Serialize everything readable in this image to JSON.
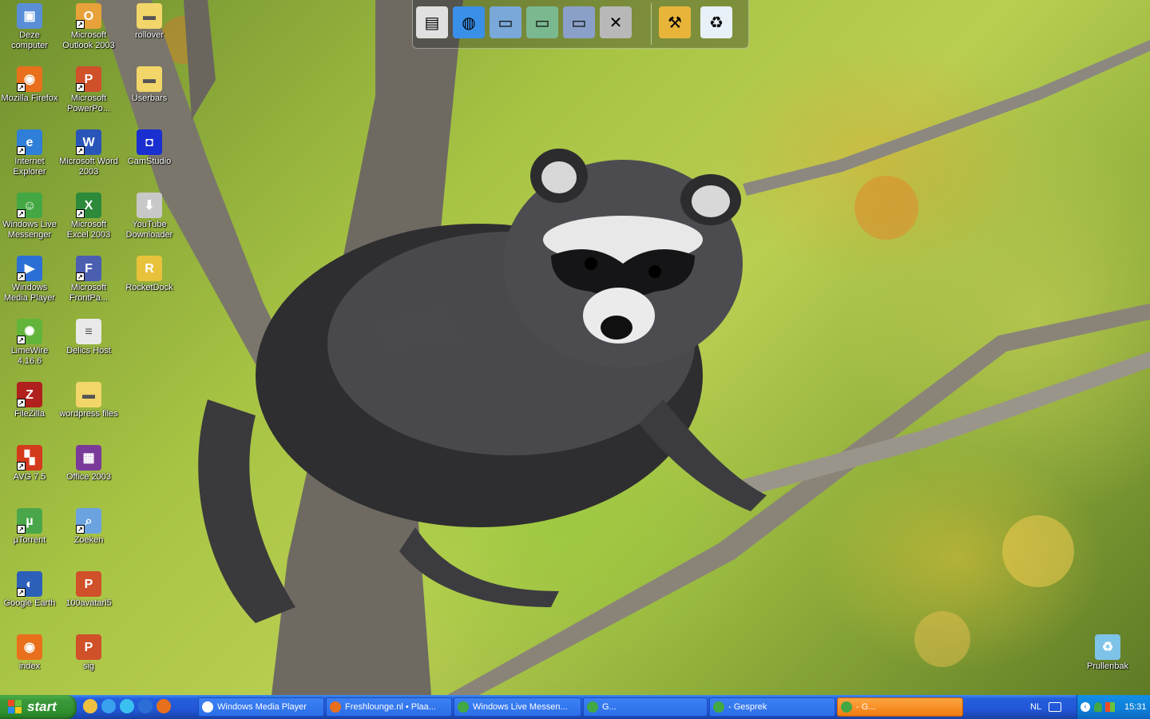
{
  "desktop": {
    "icons": [
      {
        "label": "Deze computer",
        "icon": "computer-icon",
        "color": "#5a8fd8",
        "shortcut": false
      },
      {
        "label": "Mozilla Firefox",
        "icon": "firefox-icon",
        "color": "#e8701c",
        "shortcut": true
      },
      {
        "label": "Internet Explorer",
        "icon": "internet-explorer-icon",
        "color": "#2f7fd8",
        "shortcut": true
      },
      {
        "label": "Windows Live Messenger",
        "icon": "messenger-icon",
        "color": "#43a844",
        "shortcut": true
      },
      {
        "label": "Windows Media Player",
        "icon": "media-player-icon",
        "color": "#2b6fd6",
        "shortcut": true
      },
      {
        "label": "LimeWire 4.16.6",
        "icon": "limewire-icon",
        "color": "#63b43a",
        "shortcut": true
      },
      {
        "label": "FileZilla",
        "icon": "filezilla-icon",
        "color": "#b0201c",
        "shortcut": true
      },
      {
        "label": "AVG 7.5",
        "icon": "avg-icon",
        "color": "#d43a1c",
        "shortcut": true
      },
      {
        "label": "µTorrent",
        "icon": "utorrent-icon",
        "color": "#4aa64a",
        "shortcut": true
      },
      {
        "label": "Google Earth",
        "icon": "google-earth-icon",
        "color": "#2c5fb8",
        "shortcut": true
      },
      {
        "label": "index",
        "icon": "firefox-document-icon",
        "color": "#e8701c",
        "shortcut": false
      },
      {
        "label": "Microsoft Outlook 2003",
        "icon": "outlook-icon",
        "color": "#e8a23a",
        "shortcut": true
      },
      {
        "label": "Microsoft PowerPo...",
        "icon": "powerpoint-icon",
        "color": "#d0502a",
        "shortcut": true
      },
      {
        "label": "Microsoft Word 2003",
        "icon": "word-icon",
        "color": "#2a55b8",
        "shortcut": true
      },
      {
        "label": "Microsoft Excel 2003",
        "icon": "excel-icon",
        "color": "#2c8a3a",
        "shortcut": true
      },
      {
        "label": "Microsoft FrontPa...",
        "icon": "frontpage-icon",
        "color": "#4a5fb0",
        "shortcut": true
      },
      {
        "label": "Delics Host",
        "icon": "text-document-icon",
        "color": "#e9e9e9",
        "shortcut": false
      },
      {
        "label": "wordpress files",
        "icon": "folder-icon",
        "color": "#f2d66a",
        "shortcut": false
      },
      {
        "label": "Office 2003",
        "icon": "winrar-archive-icon",
        "color": "#7a3a9a",
        "shortcut": false
      },
      {
        "label": "Zoeken",
        "icon": "search-icon",
        "color": "#6aa3e0",
        "shortcut": true
      },
      {
        "label": "100avatarl5",
        "icon": "powerpoint-document-icon",
        "color": "#d0502a",
        "shortcut": false
      },
      {
        "label": "sig",
        "icon": "powerpoint-document-icon",
        "color": "#d0502a",
        "shortcut": false
      },
      {
        "label": "rollover",
        "icon": "folder-icon",
        "color": "#f2d66a",
        "shortcut": false
      },
      {
        "label": "Userbars",
        "icon": "folder-icon",
        "color": "#f2d66a",
        "shortcut": false
      },
      {
        "label": "CamStudio",
        "icon": "camstudio-icon",
        "color": "#1a2fd0",
        "shortcut": false
      },
      {
        "label": "YouTube Downloader",
        "icon": "youtube-downloader-icon",
        "color": "#c8c8c8",
        "shortcut": false
      },
      {
        "label": "RocketDock",
        "icon": "rocketdock-icon",
        "color": "#e8c23a",
        "shortcut": false
      },
      {
        "label": "Prullenbak",
        "icon": "recycle-bin-icon",
        "color": "#7ec3e8",
        "shortcut": false
      }
    ]
  },
  "dock": {
    "items": [
      {
        "icon": "documents-icon",
        "glyph": "▤",
        "color": "#e0e0e0"
      },
      {
        "icon": "network-globe-icon",
        "glyph": "◍",
        "color": "#3a8fe8"
      },
      {
        "icon": "folder-blue-icon",
        "glyph": "▭",
        "color": "#7aa8d8"
      },
      {
        "icon": "folder-green-icon",
        "glyph": "▭",
        "color": "#7ab890"
      },
      {
        "icon": "folder-settings-icon",
        "glyph": "▭",
        "color": "#8aa0c8"
      },
      {
        "icon": "tools-icon",
        "glyph": "✕",
        "color": "#b8b8b8"
      },
      {
        "icon": "hammer-wrench-icon",
        "glyph": "⚒",
        "color": "#e8b43a"
      },
      {
        "icon": "recycle-bin-icon",
        "glyph": "♻",
        "color": "#e8f0f8"
      }
    ]
  },
  "taskbar": {
    "start_label": "start",
    "quick_launch": [
      {
        "icon": "clock-icon",
        "color": "#f0c040"
      },
      {
        "icon": "internet-explorer-icon",
        "color": "#3aa0f0"
      },
      {
        "icon": "ie-alt-icon",
        "color": "#3ac0f0"
      },
      {
        "icon": "media-player-icon",
        "color": "#2b6fd6"
      },
      {
        "icon": "firefox-icon",
        "color": "#e8701c"
      }
    ],
    "tasks": [
      {
        "label": "Windows Media Player",
        "icon": "media-player-icon",
        "color": "#ffffff",
        "flash": false
      },
      {
        "label": "Freshlounge.nl • Plaa...",
        "icon": "firefox-icon",
        "color": "#e8701c",
        "flash": false
      },
      {
        "label": "Windows Live Messen...",
        "icon": "messenger-icon",
        "color": "#43a844",
        "flash": false
      },
      {
        "label": "G...",
        "icon": "messenger-contact-icon",
        "color": "#43a844",
        "flash": false
      },
      {
        "label": "- Gesprek",
        "icon": "messenger-contact-icon",
        "color": "#43a844",
        "flash": false
      },
      {
        "label": "- G...",
        "icon": "messenger-contact-icon",
        "color": "#43a844",
        "flash": true
      }
    ],
    "language": "NL",
    "clock": "15:31"
  }
}
